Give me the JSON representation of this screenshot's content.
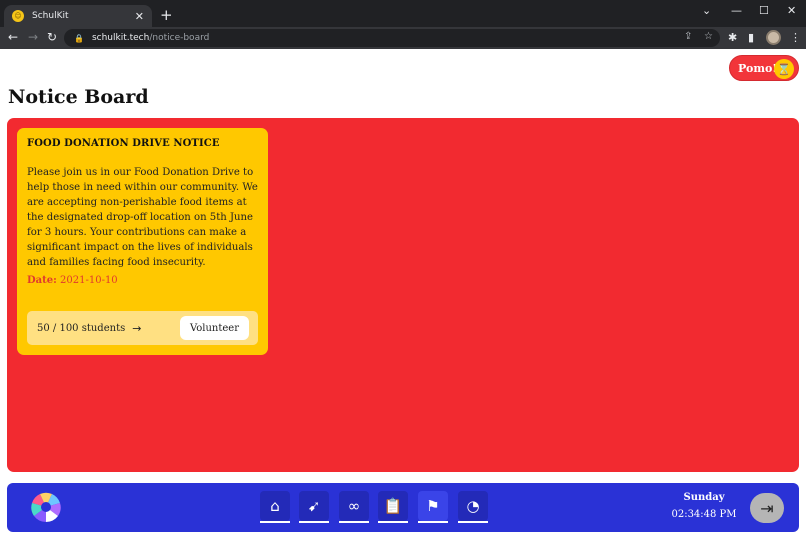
{
  "browser": {
    "tab_title": "SchulKit",
    "tab_close": "✕",
    "new_tab": "+",
    "url_domain": "schulkit.tech",
    "url_path": "/notice-board",
    "controls": {
      "minimize": "⌄",
      "restore": "—",
      "maximize": "☐",
      "close": "✕"
    }
  },
  "pomo": {
    "label": "Pomo!",
    "icon": "hourglass-icon"
  },
  "page": {
    "title": "Notice Board"
  },
  "colors": {
    "board": "#f22a30",
    "card": "#ffc800",
    "nav": "#2a32d6",
    "accent_red": "#e03a2d"
  },
  "notices": [
    {
      "title": "FOOD DONATION DRIVE NOTICE",
      "body": "Please join us in our Food Donation Drive to help those in need within our community. We are accepting non-perishable food items at the designated drop-off location on 5th June for 3 hours. Your contributions can make a significant impact on the lives of individuals and families facing food insecurity.",
      "date_label": "Date:",
      "date_value": "2021-10-10",
      "participants": "50 / 100 students",
      "action_label": "Volunteer"
    }
  ],
  "bottom_nav": {
    "items": [
      {
        "name": "home-icon"
      },
      {
        "name": "pointer-icon"
      },
      {
        "name": "loop-icon"
      },
      {
        "name": "clipboard-icon"
      },
      {
        "name": "flag-icon"
      },
      {
        "name": "timer-icon"
      }
    ],
    "active_index": 4,
    "day": "Sunday",
    "time": "02:34:48 PM"
  }
}
